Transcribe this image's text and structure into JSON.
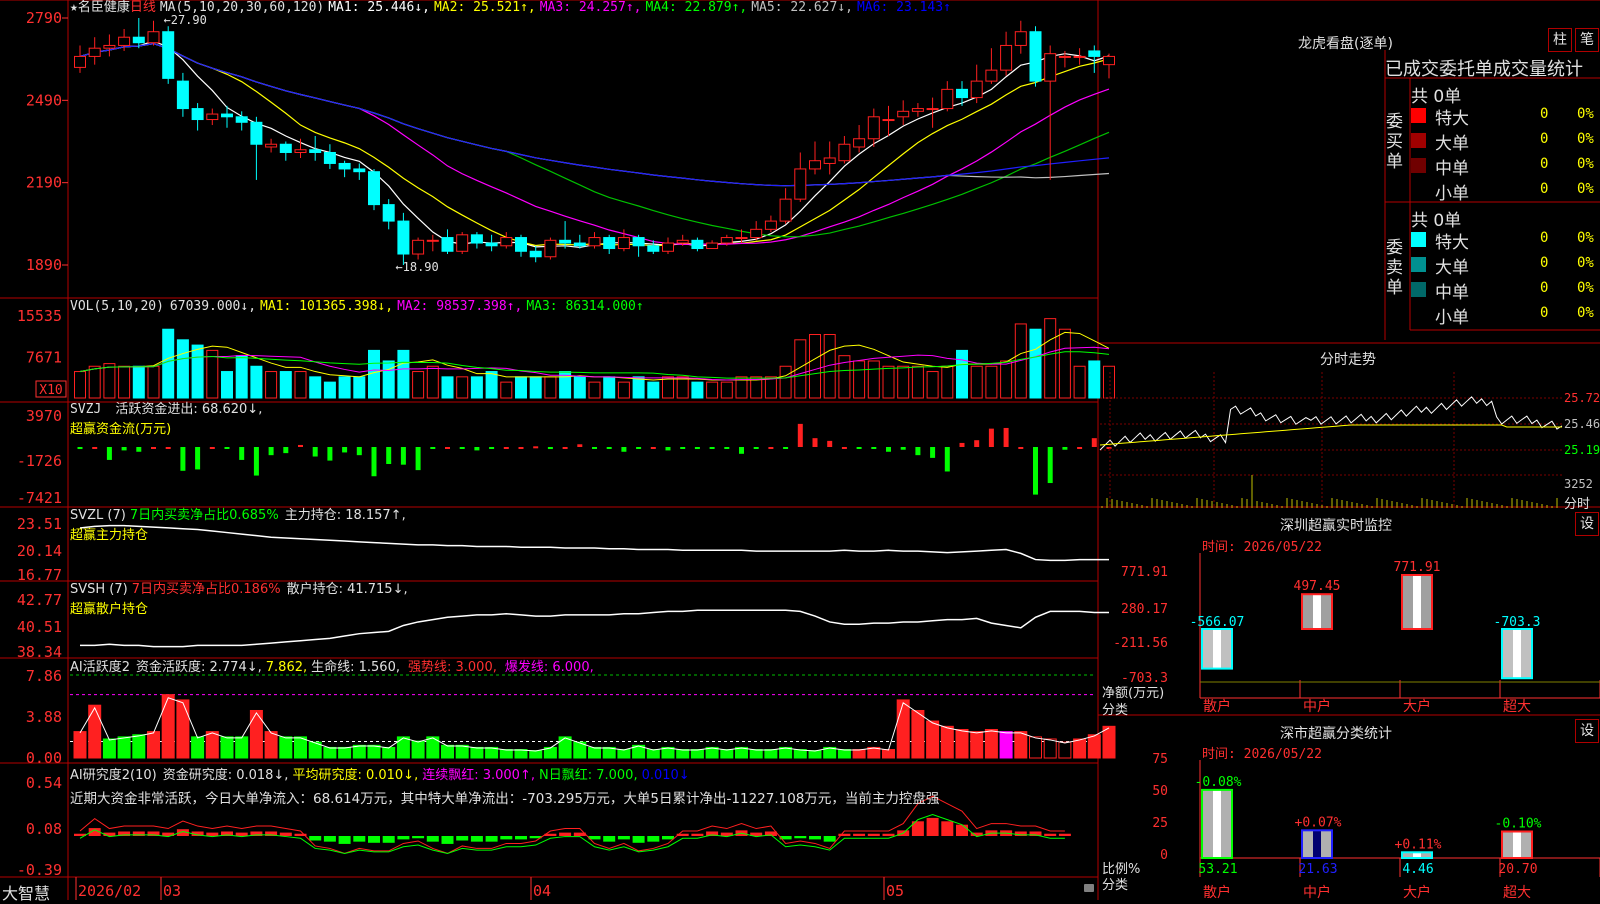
{
  "stock": {
    "name": "名臣健康",
    "star": "★",
    "period": "日线"
  },
  "price_header": {
    "label": "MA(5,10,20,30,60,120)",
    "items": [
      {
        "text": "MA1: 25.446↓,",
        "color": "#ffffff"
      },
      {
        "text": "MA2: 25.521↑,",
        "color": "#ffff00"
      },
      {
        "text": "MA3: 24.257↑,",
        "color": "#ff00ff"
      },
      {
        "text": "MA4: 22.879↑,",
        "color": "#00ff00"
      },
      {
        "text": "MA5: 22.627↓,",
        "color": "#c0c0c0"
      },
      {
        "text": "MA6: 23.143↑",
        "color": "#0000ff"
      }
    ]
  },
  "price_axis": [
    "2790",
    "2490",
    "2190",
    "1890"
  ],
  "price_annotations": {
    "high": "←27.90",
    "low": "←18.90"
  },
  "vol_header": {
    "label": "VOL(5,10,20)",
    "v": "67039.000↓,",
    "ma1": "MA1: 101365.398↓,",
    "ma2": "MA2: 98537.398↑,",
    "ma3": "MA3: 86314.000↑"
  },
  "vol_axis": [
    "15535",
    "7671"
  ],
  "vol_unit": "X10",
  "svzj": {
    "title": "SVZJ",
    "item": "活跃资金进出: 68.620↓,",
    "subtitle": "超赢资金流(万元)",
    "axis": [
      "3970",
      "-1726",
      "-7421"
    ]
  },
  "svzl": {
    "title": "SVZL (7)",
    "item1": "7日内买卖净占比0.685%",
    "item2": "主力持仓: 18.157↑,",
    "subtitle": "超赢主力持仓",
    "axis": [
      "23.51",
      "20.14",
      "16.77"
    ]
  },
  "svsh": {
    "title": "SVSH (7)",
    "item1": "7日内买卖净占比0.186%",
    "item2": "散户持仓: 41.715↓,",
    "subtitle": "超赢散户持仓",
    "axis": [
      "42.77",
      "40.51",
      "38.34"
    ]
  },
  "ai_active": {
    "title": "AI活跃度2",
    "item1": "资金活跃度: 2.774↓,",
    "item2": "7.862,",
    "item3": "生命线: 1.560,",
    "item4": "强势线: 3.000,",
    "item5": "爆发线: 6.000,",
    "axis": [
      "7.86",
      "3.88",
      "0.00"
    ]
  },
  "ai_research": {
    "title": "AI研究度2(10)",
    "item1": "资金研究度: 0.018↓,",
    "item2": "平均研究度: 0.010↓,",
    "item3": "连续飘红: 3.000↑,",
    "item4": "N日飘红: 7.000,",
    "item5": "0.010↓",
    "note": "近期大资金非常活跃，今日大单净流入：68.614万元，其中特大单净流出：-703.295万元，大单5日累计净出-11227.108万元，当前主力控盘强",
    "axis": [
      "0.54",
      "0.08",
      "-0.39"
    ]
  },
  "x_axis": [
    "2026/02",
    "03",
    "04",
    "05"
  ],
  "brand": "大智慧",
  "right": {
    "lhb_title": "龙虎看盘(逐单)",
    "btn1": "柱",
    "btn2": "笔",
    "stat_header": "已成交委托单成交量统计",
    "buy_label": "委买单",
    "sell_label": "委卖单",
    "buy_total": "共 0单",
    "sell_total": "共 0单",
    "buy_rows": [
      {
        "name": "特大",
        "v": "0",
        "p": "0%",
        "c": "#ff0000"
      },
      {
        "name": "大单",
        "v": "0",
        "p": "0%",
        "c": "#a00000"
      },
      {
        "name": "中单",
        "v": "0",
        "p": "0%",
        "c": "#700000"
      },
      {
        "name": "小单",
        "v": "0",
        "p": "0%",
        "c": "#000000"
      }
    ],
    "sell_rows": [
      {
        "name": "特大",
        "v": "0",
        "p": "0%",
        "c": "#00ffff"
      },
      {
        "name": "大单",
        "v": "0",
        "p": "0%",
        "c": "#009090"
      },
      {
        "name": "中单",
        "v": "0",
        "p": "0%",
        "c": "#006868"
      },
      {
        "name": "小单",
        "v": "0",
        "p": "0%",
        "c": "#000000"
      }
    ],
    "fs_title": "分时走势",
    "fs_axis": [
      "25.72",
      "25.46",
      "25.19"
    ],
    "fs_vol": "3252",
    "fs_vol_unit": "分时",
    "monitor_title": "深圳超赢实时监控",
    "monitor_time": "时间: 2026/05/22",
    "monitor_axis": [
      "771.91",
      "280.17",
      "-211.56",
      "-703.3"
    ],
    "monitor_ylabel": "净额(万元)",
    "monitor_cat_label": "分类",
    "monitor_bars": [
      {
        "cat": "散户",
        "value": -566.07,
        "label": "-566.07"
      },
      {
        "cat": "中户",
        "value": 497.45,
        "label": "497.45"
      },
      {
        "cat": "大户",
        "value": 771.91,
        "label": "771.91"
      },
      {
        "cat": "超大",
        "value": -703.3,
        "label": "-703.3"
      }
    ],
    "stat_title": "深市超赢分类统计",
    "stat_time": "时间: 2026/05/22",
    "stat_axis": [
      "75",
      "50",
      "25",
      "0"
    ],
    "stat_ylabel": "比例%",
    "stat_cat_label": "分类",
    "stat_bars": [
      {
        "cat": "散户",
        "value": 53.21,
        "label": "53.21",
        "change": "-0.08%"
      },
      {
        "cat": "中户",
        "value": 21.63,
        "label": "21.63",
        "change": "+0.07%"
      },
      {
        "cat": "大户",
        "value": 4.46,
        "label": "4.46",
        "change": "+0.11%"
      },
      {
        "cat": "超大",
        "value": 20.7,
        "label": "20.70",
        "change": "-0.10%"
      }
    ],
    "settings": "设"
  },
  "chart_data": [
    {
      "type": "candlestick",
      "title": "名臣健康 日线",
      "candles": [
        [
          26.1,
          26.5,
          26.9,
          25.9
        ],
        [
          26.5,
          26.8,
          27.2,
          26.2
        ],
        [
          26.8,
          26.9,
          27.3,
          26.5
        ],
        [
          26.9,
          27.2,
          27.5,
          26.7
        ],
        [
          27.2,
          27.0,
          27.9,
          26.8
        ],
        [
          27.0,
          27.4,
          27.8,
          26.9
        ],
        [
          27.4,
          25.7,
          27.6,
          25.5
        ],
        [
          25.6,
          24.6,
          25.9,
          24.3
        ],
        [
          24.6,
          24.2,
          24.8,
          23.8
        ],
        [
          24.2,
          24.4,
          24.6,
          24.0
        ],
        [
          24.4,
          24.3,
          24.7,
          23.9
        ],
        [
          24.3,
          24.1,
          24.5,
          23.8
        ],
        [
          24.1,
          23.3,
          24.3,
          22.0
        ],
        [
          23.2,
          23.3,
          23.5,
          23.0
        ],
        [
          23.3,
          23.0,
          23.4,
          22.7
        ],
        [
          23.0,
          23.1,
          23.5,
          22.8
        ],
        [
          23.1,
          23.0,
          23.6,
          22.7
        ],
        [
          23.0,
          22.6,
          23.3,
          22.4
        ],
        [
          22.6,
          22.4,
          22.7,
          22.1
        ],
        [
          22.4,
          22.3,
          22.6,
          22.0
        ],
        [
          22.3,
          21.1,
          22.4,
          20.9
        ],
        [
          21.1,
          20.5,
          21.3,
          20.2
        ],
        [
          20.5,
          19.3,
          20.8,
          18.9
        ],
        [
          19.3,
          19.8,
          19.9,
          19.1
        ],
        [
          19.8,
          19.8,
          20.0,
          19.4
        ],
        [
          19.9,
          19.4,
          20.2,
          19.3
        ],
        [
          19.4,
          20.0,
          20.1,
          19.3
        ],
        [
          20.0,
          19.7,
          20.1,
          19.5
        ],
        [
          19.7,
          19.6,
          20.0,
          19.4
        ],
        [
          19.6,
          19.9,
          20.1,
          19.5
        ],
        [
          19.9,
          19.4,
          20.0,
          19.2
        ],
        [
          19.4,
          19.2,
          19.6,
          19.0
        ],
        [
          19.2,
          19.8,
          19.9,
          19.1
        ],
        [
          19.8,
          19.7,
          20.5,
          19.5
        ],
        [
          19.7,
          19.6,
          20.0,
          19.5
        ],
        [
          19.6,
          19.9,
          20.1,
          19.5
        ],
        [
          19.9,
          19.5,
          20.0,
          19.3
        ],
        [
          19.5,
          19.9,
          20.2,
          19.4
        ],
        [
          19.9,
          19.6,
          20.0,
          19.2
        ],
        [
          19.6,
          19.4,
          19.8,
          19.3
        ],
        [
          19.4,
          19.7,
          19.9,
          19.3
        ],
        [
          19.7,
          19.8,
          20.0,
          19.6
        ],
        [
          19.8,
          19.5,
          19.9,
          19.4
        ],
        [
          19.5,
          19.7,
          19.8,
          19.5
        ],
        [
          19.7,
          19.9,
          20.0,
          19.6
        ],
        [
          19.9,
          19.9,
          20.2,
          19.7
        ],
        [
          19.9,
          20.2,
          20.5,
          19.8
        ],
        [
          20.2,
          20.5,
          20.7,
          20.1
        ],
        [
          20.5,
          21.3,
          21.7,
          20.4
        ],
        [
          21.3,
          22.4,
          23.0,
          21.2
        ],
        [
          22.4,
          22.7,
          23.4,
          22.2
        ],
        [
          22.6,
          22.8,
          23.4,
          22.2
        ],
        [
          22.7,
          23.3,
          23.6,
          22.6
        ],
        [
          23.2,
          23.5,
          24.0,
          23.0
        ],
        [
          23.5,
          24.3,
          24.6,
          23.2
        ],
        [
          24.2,
          24.2,
          24.7,
          23.6
        ],
        [
          24.3,
          24.5,
          24.9,
          24.0
        ],
        [
          24.5,
          24.6,
          24.8,
          24.3
        ],
        [
          24.6,
          24.6,
          25.0,
          23.9
        ],
        [
          24.6,
          25.3,
          25.6,
          24.5
        ],
        [
          25.3,
          25.0,
          25.6,
          24.7
        ],
        [
          25.0,
          25.6,
          26.2,
          24.8
        ],
        [
          25.6,
          26.0,
          26.8,
          25.5
        ],
        [
          26.0,
          26.9,
          27.4,
          25.8
        ],
        [
          26.9,
          27.4,
          27.8,
          26.6
        ],
        [
          27.4,
          25.6,
          27.6,
          25.4
        ],
        [
          25.6,
          26.6,
          26.9,
          22.0
        ],
        [
          26.5,
          26.5,
          26.7,
          26.1
        ],
        [
          26.5,
          26.5,
          26.8,
          26.2
        ],
        [
          26.7,
          26.5,
          26.9,
          25.9
        ],
        [
          26.2,
          26.5,
          26.6,
          25.7
        ]
      ]
    },
    {
      "type": "bar",
      "title": "VOL(5,10,20)",
      "values": [
        5,
        6,
        6.5,
        6,
        6,
        6,
        13,
        11,
        10,
        9,
        5,
        8,
        6,
        5,
        5,
        5,
        4,
        3,
        4,
        4,
        9,
        7,
        9,
        5,
        6,
        4,
        4,
        4,
        5,
        3,
        4,
        4,
        4,
        5,
        4,
        3,
        4,
        3,
        4,
        3,
        4,
        4,
        3,
        3,
        3,
        4,
        4,
        4,
        6,
        11,
        12,
        12,
        8,
        7,
        7,
        6,
        6,
        6,
        5,
        6,
        9,
        6,
        6,
        7,
        14,
        13,
        15,
        13,
        6,
        7,
        6
      ]
    },
    {
      "type": "bar",
      "title": "超赢资金流(万元)",
      "values": [
        -300,
        0,
        -1900,
        -500,
        -700,
        0,
        0,
        -3500,
        -3300,
        0,
        -200,
        -1900,
        -4200,
        -1200,
        -900,
        300,
        -1400,
        -2000,
        -800,
        -1200,
        -4300,
        -2500,
        -2600,
        -3400,
        -200,
        0,
        -200,
        -500,
        -200,
        0,
        0,
        100,
        -300,
        0,
        400,
        -200,
        -200,
        -700,
        -200,
        0,
        -500,
        -200,
        -300,
        -100,
        -100,
        -1000,
        -200,
        0,
        -100,
        3400,
        1300,
        900,
        0,
        -200,
        -100,
        -700,
        -400,
        -1200,
        -1600,
        -3600,
        600,
        1000,
        2700,
        2800,
        0,
        -7000,
        -5300,
        -400,
        0,
        1300,
        0
      ]
    },
    {
      "type": "line",
      "title": "超赢主力持仓",
      "values": [
        23.0,
        23.2,
        23.3,
        23.3,
        23.2,
        23.1,
        23.0,
        22.9,
        22.8,
        22.6,
        22.4,
        22.2,
        22.0,
        21.8,
        21.7,
        21.6,
        21.5,
        21.4,
        21.3,
        21.2,
        21.1,
        21.0,
        20.9,
        20.8,
        20.8,
        20.7,
        20.7,
        20.6,
        20.6,
        20.6,
        20.5,
        20.5,
        20.5,
        20.4,
        20.4,
        20.4,
        20.3,
        20.3,
        20.2,
        20.2,
        20.2,
        20.1,
        20.1,
        20.1,
        20.1,
        20.1,
        20.0,
        20.0,
        20.0,
        20.0,
        20.0,
        20.0,
        20.1,
        20.0,
        20.0,
        20.1,
        20.0,
        20.0,
        19.9,
        19.8,
        19.9,
        20.0,
        20.1,
        20.2,
        19.7,
        18.9,
        18.8,
        18.8,
        18.9,
        18.9,
        18.9
      ]
    },
    {
      "type": "line",
      "title": "超赢散户持仓",
      "values": [
        38.9,
        38.9,
        39.0,
        38.9,
        38.9,
        38.8,
        38.8,
        38.8,
        38.9,
        38.9,
        38.9,
        38.9,
        39.0,
        39.1,
        39.2,
        39.3,
        39.4,
        39.5,
        39.7,
        39.9,
        40.0,
        40.1,
        40.6,
        40.9,
        41.1,
        41.3,
        41.4,
        41.5,
        41.5,
        41.6,
        41.5,
        41.4,
        41.4,
        41.5,
        41.5,
        41.5,
        41.5,
        41.6,
        41.6,
        41.7,
        41.8,
        41.8,
        41.9,
        41.9,
        41.9,
        41.9,
        41.9,
        41.9,
        41.9,
        41.8,
        41.4,
        40.9,
        40.7,
        40.7,
        40.8,
        40.8,
        40.9,
        40.9,
        41.0,
        41.1,
        41.1,
        41.2,
        40.8,
        40.6,
        40.4,
        41.3,
        41.8,
        41.8,
        41.8,
        41.7,
        41.7
      ]
    },
    {
      "type": "bar",
      "title": "AI活跃度2",
      "values": [
        2.5,
        5.0,
        1.8,
        2.0,
        2.2,
        2.5,
        6.0,
        5.5,
        2.0,
        2.5,
        2.0,
        2.0,
        4.5,
        2.5,
        2.0,
        2.0,
        1.5,
        1.0,
        1.0,
        1.2,
        1.2,
        1.0,
        2.0,
        1.6,
        2.0,
        1.2,
        1.2,
        1.0,
        1.0,
        0.8,
        0.8,
        0.7,
        1.0,
        2.0,
        1.5,
        1.0,
        1.0,
        0.8,
        1.2,
        0.8,
        1.0,
        0.8,
        0.8,
        1.0,
        0.8,
        1.0,
        0.8,
        0.8,
        1.0,
        0.8,
        0.7,
        1.0,
        0.8,
        0.8,
        1.0,
        0.8,
        5.5,
        4.5,
        3.5,
        3.0,
        2.7,
        2.5,
        2.7,
        2.5,
        2.5,
        2.0,
        1.8,
        1.5,
        1.8,
        2.2,
        3.0,
        3.5,
        6.0,
        5.0,
        4.5,
        4.2,
        3.8,
        3.5,
        3.0,
        2.6
      ]
    },
    {
      "type": "bar",
      "title": "AI研究度2(10)",
      "values": [
        0.02,
        0.07,
        0.03,
        0.04,
        0.04,
        0.04,
        0.03,
        0.06,
        0.04,
        0.03,
        0.04,
        0.03,
        0.04,
        0.04,
        0.03,
        0.02,
        -0.04,
        -0.05,
        -0.07,
        -0.05,
        -0.06,
        -0.06,
        -0.03,
        -0.02,
        -0.05,
        -0.07,
        -0.04,
        -0.05,
        -0.05,
        -0.03,
        -0.03,
        -0.02,
        0.02,
        0.03,
        0.03,
        -0.03,
        -0.05,
        -0.03,
        -0.06,
        -0.05,
        -0.03,
        0.02,
        0.02,
        0.04,
        0.03,
        0.05,
        0.03,
        0.04,
        -0.03,
        -0.02,
        -0.03,
        -0.05,
        0.02,
        0.02,
        0.02,
        0.02,
        0.05,
        0.13,
        0.16,
        0.13,
        0.1,
        0.03,
        0.05,
        0.05,
        0.04,
        0.04,
        0.02,
        0.02
      ]
    }
  ]
}
